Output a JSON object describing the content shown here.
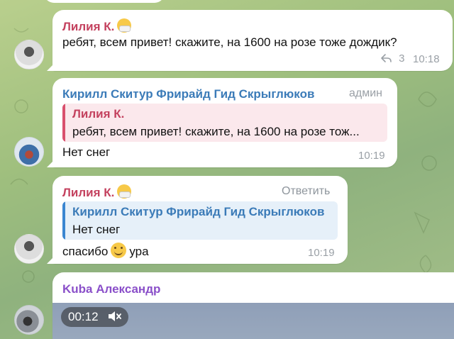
{
  "messages": [
    {
      "sender": "Лилия К.",
      "text": "ребят, всем привет! скажите, на 1600 на розе тоже дождик?",
      "replies_count": "3",
      "time": "10:18"
    },
    {
      "sender": "Кирилл Скитур Фрирайд Гид Скрыглюков",
      "role": "админ",
      "quote_sender": "Лилия К.",
      "quote_text": "ребят, всем привет! скажите, на 1600 на розе тож...",
      "text": "Нет снег",
      "time": "10:19"
    },
    {
      "sender": "Лилия К.",
      "reply_action": "Ответить",
      "quote_sender": "Кирилл Скитур Фрирайд Гид Скрыглюков",
      "quote_text": "Нет снег",
      "text_before": "спасибо",
      "text_after": "ура",
      "time": "10:19"
    },
    {
      "sender": "Kuba Александр",
      "video_duration": "00:12"
    }
  ],
  "icons": {
    "reply": "reply-arrow-icon",
    "emoji_mask": "face-with-medical-mask-emoji",
    "emoji_smile": "smiling-face-emoji",
    "mute": "muted-speaker-icon"
  },
  "colors": {
    "pink_sender": "#c4425f",
    "blue_sender": "#3b7bb8",
    "purple_sender": "#8a4fc9",
    "meta_gray": "#9aa0a6"
  }
}
